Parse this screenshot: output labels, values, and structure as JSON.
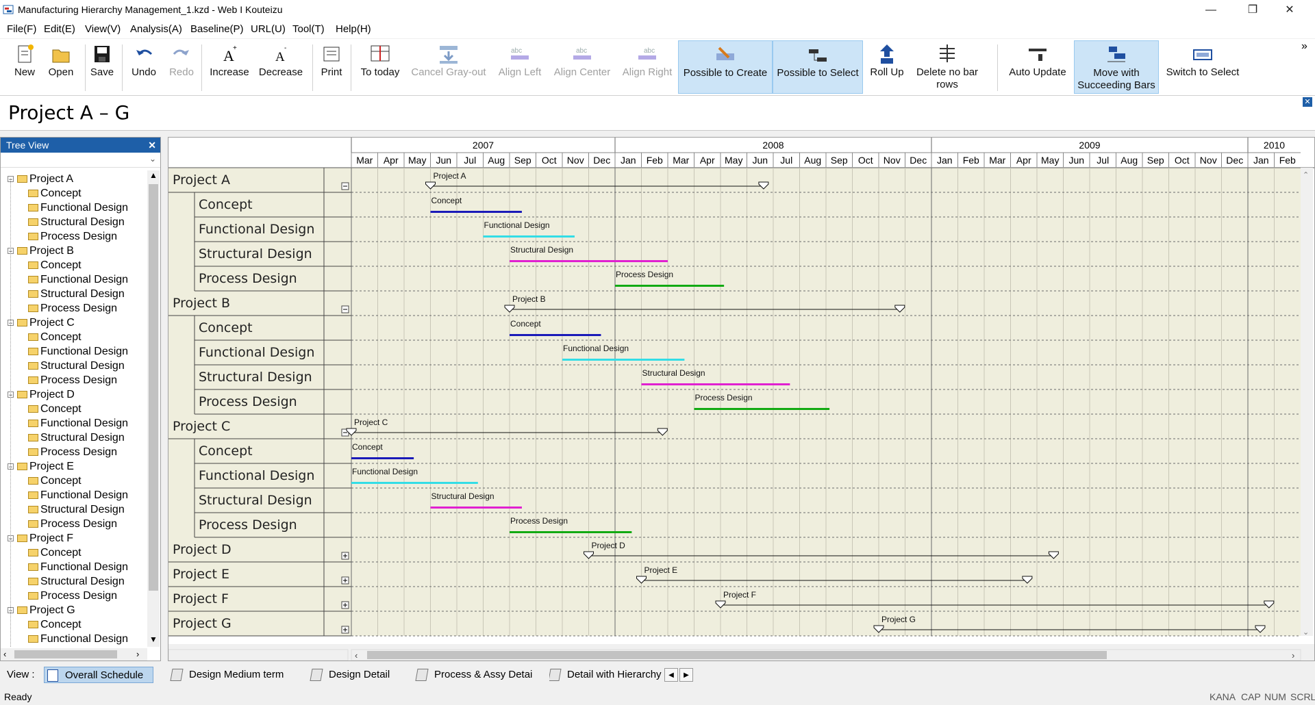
{
  "window": {
    "title": "Manufacturing Hierarchy Management_1.kzd - Web I Kouteizu",
    "controls": {
      "minimize": "—",
      "restore": "❐",
      "close": "✕"
    }
  },
  "menu": [
    "File(F)",
    "Edit(E)",
    "View(V)",
    "Analysis(A)",
    "Baseline(P)",
    "URL(U)",
    "Tool(T)",
    "Help(H)"
  ],
  "toolbar": {
    "new": "New",
    "open": "Open",
    "save": "Save",
    "undo": "Undo",
    "redo": "Redo",
    "increase": "Increase",
    "decrease": "Decrease",
    "print": "Print",
    "to_today": "To today",
    "cancel_grayout": "Cancel Gray-out",
    "align_left": "Align Left",
    "align_center": "Align Center",
    "align_right": "Align Right",
    "possible_create": "Possible to Create",
    "possible_select": "Possible to Select",
    "roll_up": "Roll Up",
    "delete_no_bar_1": "Delete no bar",
    "delete_no_bar_2": "rows",
    "auto_update": "Auto Update",
    "move_succ_1": "Move with",
    "move_succ_2": "Succeeding Bars",
    "switch_select": "Switch to Select",
    "overflow": "»"
  },
  "page_title": "Project A – G",
  "tree": {
    "header": "Tree View",
    "close": "✕",
    "items": [
      {
        "label": "Project A",
        "level": 0
      },
      {
        "label": "Concept",
        "level": 1
      },
      {
        "label": "Functional Design",
        "level": 1
      },
      {
        "label": "Structural Design",
        "level": 1
      },
      {
        "label": "Process Design",
        "level": 1
      },
      {
        "label": "Project B",
        "level": 0
      },
      {
        "label": "Concept",
        "level": 1
      },
      {
        "label": "Functional Design",
        "level": 1
      },
      {
        "label": "Structural Design",
        "level": 1
      },
      {
        "label": "Process Design",
        "level": 1
      },
      {
        "label": "Project C",
        "level": 0
      },
      {
        "label": "Concept",
        "level": 1
      },
      {
        "label": "Functional Design",
        "level": 1
      },
      {
        "label": "Structural Design",
        "level": 1
      },
      {
        "label": "Process Design",
        "level": 1
      },
      {
        "label": "Project D",
        "level": 0
      },
      {
        "label": "Concept",
        "level": 1
      },
      {
        "label": "Functional Design",
        "level": 1
      },
      {
        "label": "Structural Design",
        "level": 1
      },
      {
        "label": "Process Design",
        "level": 1
      },
      {
        "label": "Project E",
        "level": 0
      },
      {
        "label": "Concept",
        "level": 1
      },
      {
        "label": "Functional Design",
        "level": 1
      },
      {
        "label": "Structural Design",
        "level": 1
      },
      {
        "label": "Process Design",
        "level": 1
      },
      {
        "label": "Project F",
        "level": 0
      },
      {
        "label": "Concept",
        "level": 1
      },
      {
        "label": "Functional Design",
        "level": 1
      },
      {
        "label": "Structural Design",
        "level": 1
      },
      {
        "label": "Process Design",
        "level": 1
      },
      {
        "label": "Project G",
        "level": 0
      },
      {
        "label": "Concept",
        "level": 1
      },
      {
        "label": "Functional Design",
        "level": 1
      }
    ]
  },
  "timeline": {
    "years": [
      {
        "label": "2007",
        "start": 0,
        "end": 10
      },
      {
        "label": "2008",
        "start": 10,
        "end": 22
      },
      {
        "label": "2009",
        "start": 22,
        "end": 34
      },
      {
        "label": "2010",
        "start": 34,
        "end": 36
      }
    ],
    "months": [
      "Mar",
      "Apr",
      "May",
      "Jun",
      "Jul",
      "Aug",
      "Sep",
      "Oct",
      "Nov",
      "Dec",
      "Jan",
      "Feb",
      "Mar",
      "Apr",
      "May",
      "Jun",
      "Jul",
      "Aug",
      "Sep",
      "Oct",
      "Nov",
      "Dec",
      "Jan",
      "Feb",
      "Mar",
      "Apr",
      "May",
      "Jun",
      "Jul",
      "Aug",
      "Sep",
      "Oct",
      "Nov",
      "Dec",
      "Jan",
      "Feb"
    ],
    "start_month": "2007-03"
  },
  "rows": [
    {
      "name": "Project A",
      "level": 0,
      "expander": "⊟",
      "bar": {
        "label": "Project A",
        "type": "summary",
        "start": "2007-06-01",
        "end": "2008-06-20"
      }
    },
    {
      "name": "Concept",
      "level": 1,
      "bar": {
        "label": "Concept",
        "type": "task",
        "start": "2007-06-01",
        "end": "2007-09-15",
        "color": "#1a1ab8"
      }
    },
    {
      "name": "Functional Design",
      "level": 1,
      "bar": {
        "label": "Functional Design",
        "type": "task",
        "start": "2007-08-01",
        "end": "2007-11-15",
        "color": "#33dde6"
      }
    },
    {
      "name": "Structural Design",
      "level": 1,
      "bar": {
        "label": "Structural Design",
        "type": "task",
        "start": "2007-09-01",
        "end": "2008-03-01",
        "color": "#e020d0"
      }
    },
    {
      "name": "Process Design",
      "level": 1,
      "bar": {
        "label": "Process Design",
        "type": "task",
        "start": "2008-01-01",
        "end": "2008-05-05",
        "color": "#12aa12"
      }
    },
    {
      "name": "Project B",
      "level": 0,
      "expander": "⊟",
      "bar": {
        "label": "Project B",
        "type": "summary",
        "start": "2007-09-01",
        "end": "2008-11-25"
      }
    },
    {
      "name": "Concept",
      "level": 1,
      "bar": {
        "label": "Concept",
        "type": "task",
        "start": "2007-09-01",
        "end": "2007-12-15",
        "color": "#1a1ab8"
      }
    },
    {
      "name": "Functional Design",
      "level": 1,
      "bar": {
        "label": "Functional Design",
        "type": "task",
        "start": "2007-11-01",
        "end": "2008-03-20",
        "color": "#33dde6"
      }
    },
    {
      "name": "Structural Design",
      "level": 1,
      "bar": {
        "label": "Structural Design",
        "type": "task",
        "start": "2008-02-01",
        "end": "2008-07-20",
        "color": "#e020d0"
      }
    },
    {
      "name": "Process Design",
      "level": 1,
      "bar": {
        "label": "Process Design",
        "type": "task",
        "start": "2008-04-01",
        "end": "2008-09-05",
        "color": "#12aa12"
      }
    },
    {
      "name": "Project C",
      "level": 0,
      "expander": "⊟",
      "bar": {
        "label": "Project C",
        "type": "summary",
        "start": "2007-03-01",
        "end": "2007-03-01",
        "end2": "2008-02-25"
      }
    },
    {
      "name": "Concept",
      "level": 1,
      "bar": {
        "label": "Concept",
        "type": "task",
        "start": "2007-03-01",
        "end": "2007-05-12",
        "color": "#1a1ab8"
      }
    },
    {
      "name": "Functional Design",
      "level": 1,
      "bar": {
        "label": "Functional Design",
        "type": "task",
        "start": "2007-03-01",
        "end": "2007-07-25",
        "color": "#33dde6"
      }
    },
    {
      "name": "Structural Design",
      "level": 1,
      "bar": {
        "label": "Structural Design",
        "type": "task",
        "start": "2007-06-01",
        "end": "2007-09-15",
        "color": "#e020d0"
      }
    },
    {
      "name": "Process Design",
      "level": 1,
      "bar": {
        "label": "Process Design",
        "type": "task",
        "start": "2007-09-01",
        "end": "2008-01-20",
        "color": "#12aa12"
      }
    },
    {
      "name": "Project D",
      "level": 0,
      "expander": "⊞",
      "bar": {
        "label": "Project D",
        "type": "summary",
        "start": "2007-12-01",
        "end": "2009-05-20"
      }
    },
    {
      "name": "Project E",
      "level": 0,
      "expander": "⊞",
      "bar": {
        "label": "Project E",
        "type": "summary",
        "start": "2008-02-01",
        "end": "2009-04-20"
      }
    },
    {
      "name": "Project F",
      "level": 0,
      "expander": "⊞",
      "bar": {
        "label": "Project F",
        "type": "summary",
        "start": "2008-05-01",
        "end": "2010-01-25"
      }
    },
    {
      "name": "Project G",
      "level": 0,
      "expander": "⊞",
      "bar": {
        "label": "Project G",
        "type": "summary",
        "start": "2008-11-01",
        "end": "2010-01-15"
      }
    }
  ],
  "colors": {
    "chart_bg": "#efeedd",
    "grid_dash": "#6a6a6a",
    "row_panel_bg": "#efeedd",
    "header_blue": "#1e5fa8"
  },
  "view_tabs": {
    "label": "View :",
    "tabs": [
      "Overall Schedule",
      "Design Medium term",
      "Design Detail",
      "Process & Assy Detai",
      "Detail with Hierarchy"
    ],
    "active": 0
  },
  "status": {
    "left": "Ready",
    "indicators": [
      "KANA",
      "CAP",
      "NUM",
      "SCRL"
    ]
  }
}
